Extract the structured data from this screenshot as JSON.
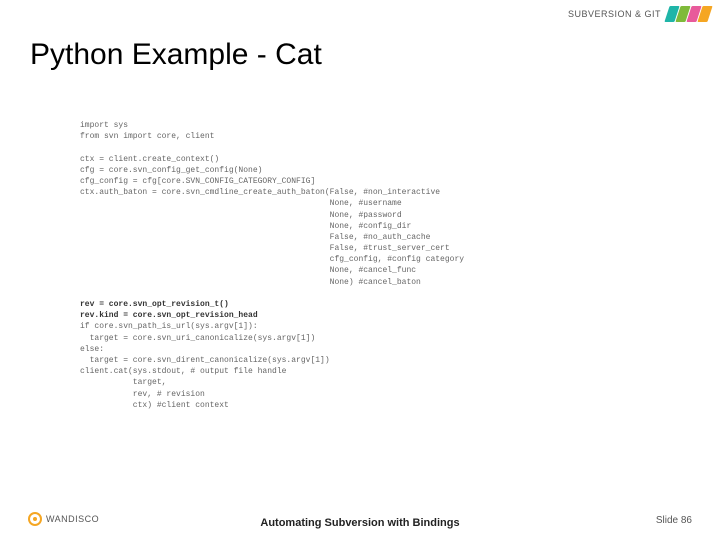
{
  "header": {
    "text": "SUBVERSION & GIT"
  },
  "title": "Python Example - Cat",
  "code": {
    "block1": "import sys\nfrom svn import core, client",
    "block2": "ctx = client.create_context()\ncfg = core.svn_config_get_config(None)\ncfg_config = cfg[core.SVN_CONFIG_CATEGORY_CONFIG]\nctx.auth_baton = core.svn_cmdline_create_auth_baton(False, #non_interactive\n                                                    None, #username\n                                                    None, #password\n                                                    None, #config_dir\n                                                    False, #no_auth_cache\n                                                    False, #trust_server_cert\n                                                    cfg_config, #config category\n                                                    None, #cancel_func\n                                                    None) #cancel_baton",
    "bold1": "rev = core.svn_opt_revision_t()\nrev.kind = core.svn_opt_revision_head",
    "block3": "if core.svn_path_is_url(sys.argv[1]):\n  target = core.svn_uri_canonicalize(sys.argv[1])\nelse:\n  target = core.svn_dirent_canonicalize(sys.argv[1])\nclient.cat(sys.stdout, # output file handle\n           target,\n           rev, # revision\n           ctx) #client context"
  },
  "footer": {
    "logo_text": "WANDISCO",
    "center": "Automating Subversion with\nBindings",
    "slide": "Slide 86"
  }
}
